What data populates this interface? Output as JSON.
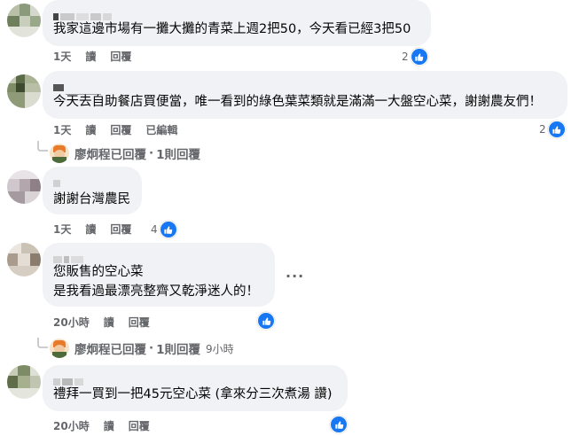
{
  "comments": [
    {
      "text_lines": [
        "我家這邊市場有一攤大攤的青菜上週2把50，今天看已經3把50"
      ],
      "time": "1天",
      "read": "讀",
      "reply": "回覆",
      "edited": "",
      "like_count": "2"
    },
    {
      "text_lines": [
        "今天去自助餐店買便當，唯一看到的綠色葉菜類就是滿滿一大盤空心菜，謝謝農友們！"
      ],
      "time": "1天",
      "read": "讀",
      "reply": "回覆",
      "edited": "已編輯",
      "like_count": "2",
      "replies_summary": {
        "name": "廖炯程已回覆",
        "sep": "·",
        "count": "1則回覆",
        "time": ""
      }
    },
    {
      "text_lines": [
        "謝謝台灣農民"
      ],
      "time": "1天",
      "read": "讀",
      "reply": "回覆",
      "edited": "",
      "like_count": "4"
    },
    {
      "text_lines": [
        "您販售的空心菜",
        "是我看過最漂亮整齊又乾淨迷人的！"
      ],
      "time": "20小時",
      "read": "讀",
      "reply": "回覆",
      "edited": "",
      "like_count": "",
      "more": "···",
      "replies_summary": {
        "name": "廖炯程已回覆",
        "sep": "·",
        "count": "1則回覆",
        "time": "9小時"
      }
    },
    {
      "text_lines": [
        "禮拜一買到一把45元空心菜 (拿來分三次煮湯 讚)"
      ],
      "time": "20小時",
      "read": "讀",
      "reply": "回覆",
      "edited": "",
      "like_count": ""
    }
  ],
  "colors": {
    "bubble": "#f0f2f5",
    "meta_text": "#65676b",
    "like_blue": "#1877f2",
    "body_text": "#050505"
  },
  "icons": {
    "like": "thumbs-up-icon",
    "reply_arrow": "reply-arrow-icon",
    "more": "more-options-icon"
  }
}
